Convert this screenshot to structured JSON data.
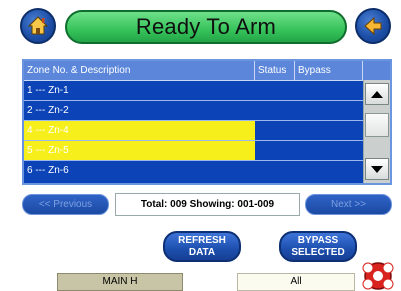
{
  "header": {
    "title": "Ready To Arm",
    "home_icon": "home-icon",
    "back_icon": "back-arrow-icon"
  },
  "zones": {
    "columns": [
      "Zone No. & Description",
      "Status",
      "Bypass"
    ],
    "rows": [
      {
        "label": "1 --- Zn-1",
        "highlighted": false
      },
      {
        "label": "2 --- Zn-2",
        "highlighted": false
      },
      {
        "label": "4 --- Zn-4",
        "highlighted": true
      },
      {
        "label": "5 --- Zn-5",
        "highlighted": true
      },
      {
        "label": "6 --- Zn-6",
        "highlighted": false
      }
    ]
  },
  "pager": {
    "previous_label": "<< Previous",
    "next_label": "Next >>",
    "summary": "Total: 009  Showing: 001-009"
  },
  "actions": {
    "refresh_line1": "REFRESH",
    "refresh_line2": "DATA",
    "bypass_line1": "BYPASS",
    "bypass_line2": "SELECTED"
  },
  "footer": {
    "partition": "MAIN H",
    "filter": "All",
    "alarm_icon": "alarm-icon"
  },
  "colors": {
    "title_green": "#36c35a",
    "panel_blue": "#0c44b8",
    "highlight_yellow": "#f6ef1c",
    "button_blue": "#1d4fae"
  }
}
